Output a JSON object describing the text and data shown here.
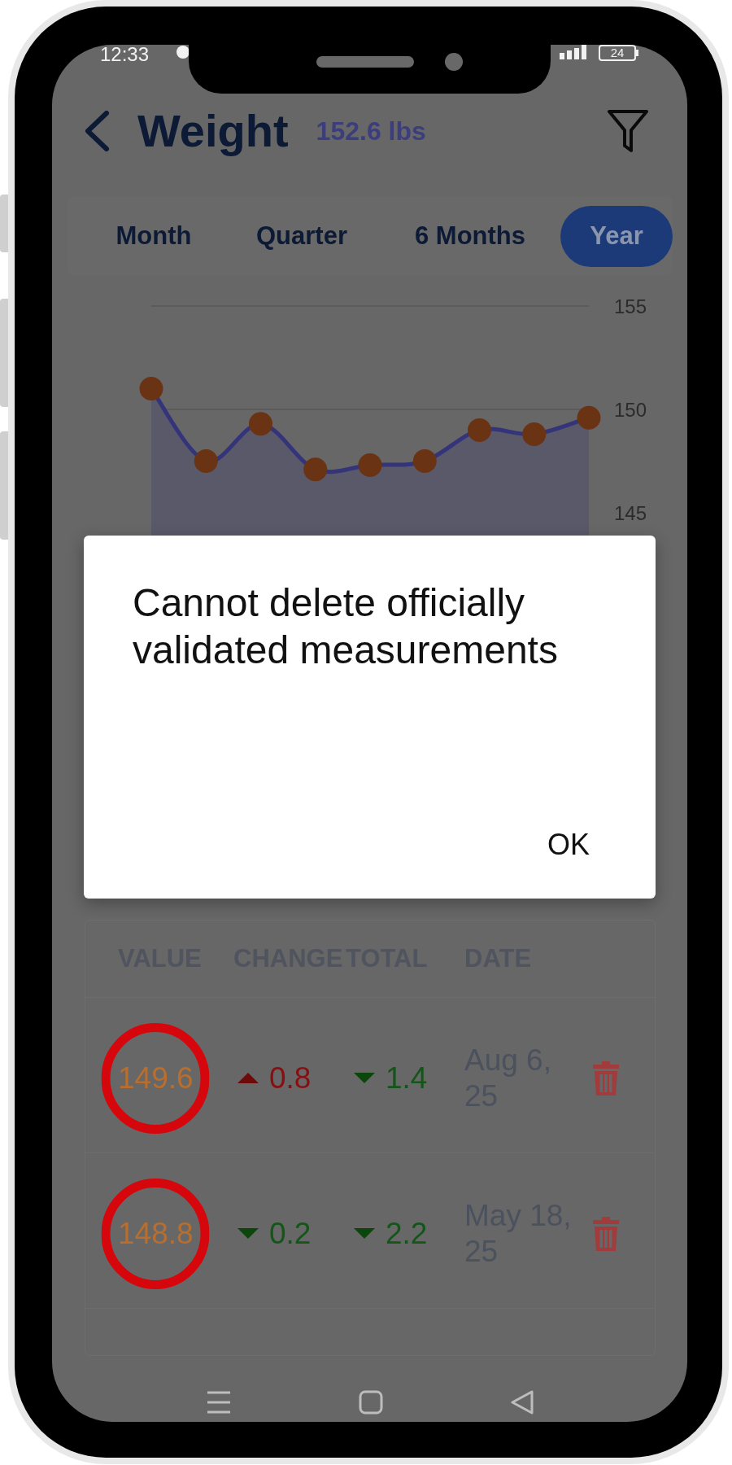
{
  "status_bar": {
    "time": "12:33",
    "battery": "24"
  },
  "header": {
    "title": "Weight",
    "current_value": "152.6 lbs"
  },
  "period_tabs": [
    {
      "label": "Month",
      "selected": false
    },
    {
      "label": "Quarter",
      "selected": false
    },
    {
      "label": "6 Months",
      "selected": false
    },
    {
      "label": "Year",
      "selected": true
    }
  ],
  "chart": {
    "chart_data": {
      "type": "area",
      "series": [
        {
          "color": "#34347a",
          "values": [
            151.0,
            147.5,
            149.3,
            147.1,
            147.3,
            147.5,
            149.0,
            148.8,
            149.6
          ]
        }
      ],
      "ylim": [
        145,
        155
      ],
      "yticks": [
        145,
        150,
        155
      ]
    }
  },
  "table": {
    "columns": [
      "VALUE",
      "CHANGE",
      "TOTAL",
      "DATE"
    ],
    "rows": [
      {
        "value": "149.6",
        "circled": true,
        "change": {
          "text": "0.8",
          "rising": true
        },
        "total": {
          "text": "1.4",
          "rising": false
        },
        "date": "Aug 6, 25"
      },
      {
        "value": "148.8",
        "circled": true,
        "change": {
          "text": "0.2",
          "rising": false
        },
        "total": {
          "text": "2.2",
          "rising": false
        },
        "date": "May 18, 25"
      }
    ]
  },
  "dialog": {
    "message": "Cannot delete officially validated measurements",
    "buttons": [
      "OK"
    ]
  }
}
